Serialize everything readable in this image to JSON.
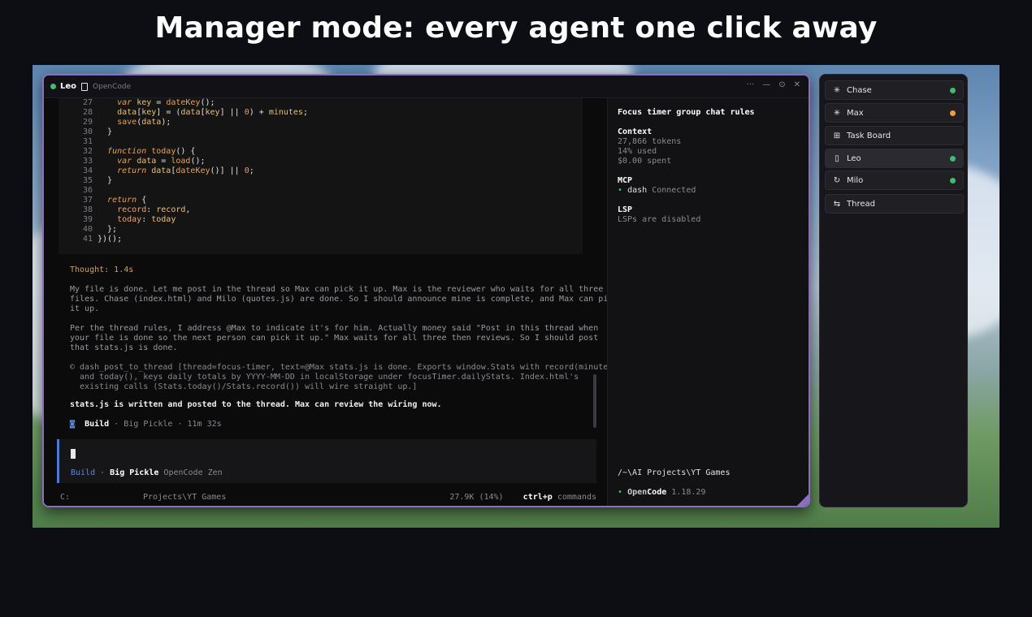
{
  "headline": "Manager mode: every agent one click away",
  "window": {
    "agent_name": "Leo",
    "app_name": "OpenCode",
    "controls": [
      "···",
      "—",
      "⊙",
      "✕"
    ]
  },
  "code": {
    "lines": [
      {
        "n": "27",
        "parts": [
          [
            "    ",
            "pl"
          ],
          [
            "var",
            "kw"
          ],
          [
            " ",
            "pl"
          ],
          [
            "key",
            "var"
          ],
          [
            " = ",
            "pl"
          ],
          [
            "dateKey",
            "fn"
          ],
          [
            "();",
            "pl"
          ]
        ]
      },
      {
        "n": "28",
        "parts": [
          [
            "    ",
            "pl"
          ],
          [
            "data",
            "var"
          ],
          [
            "[",
            "pl"
          ],
          [
            "key",
            "var"
          ],
          [
            "] = (",
            "pl"
          ],
          [
            "data",
            "var"
          ],
          [
            "[",
            "pl"
          ],
          [
            "key",
            "var"
          ],
          [
            "] || ",
            "pl"
          ],
          [
            "0",
            "num"
          ],
          [
            ") + ",
            "pl"
          ],
          [
            "minutes",
            "var"
          ],
          [
            ";",
            "pl"
          ]
        ]
      },
      {
        "n": "29",
        "parts": [
          [
            "    ",
            "pl"
          ],
          [
            "save",
            "fn"
          ],
          [
            "(",
            "pl"
          ],
          [
            "data",
            "var"
          ],
          [
            ");",
            "pl"
          ]
        ]
      },
      {
        "n": "30",
        "parts": [
          [
            "  }",
            "pl"
          ]
        ]
      },
      {
        "n": "31",
        "parts": [
          [
            "",
            "pl"
          ]
        ]
      },
      {
        "n": "32",
        "parts": [
          [
            "  ",
            "pl"
          ],
          [
            "function",
            "kw"
          ],
          [
            " ",
            "pl"
          ],
          [
            "today",
            "fn"
          ],
          [
            "() {",
            "pl"
          ]
        ]
      },
      {
        "n": "33",
        "parts": [
          [
            "    ",
            "pl"
          ],
          [
            "var",
            "kw"
          ],
          [
            " ",
            "pl"
          ],
          [
            "data",
            "var"
          ],
          [
            " = ",
            "pl"
          ],
          [
            "load",
            "fn"
          ],
          [
            "();",
            "pl"
          ]
        ]
      },
      {
        "n": "34",
        "parts": [
          [
            "    ",
            "pl"
          ],
          [
            "return",
            "kw"
          ],
          [
            " ",
            "pl"
          ],
          [
            "data",
            "var"
          ],
          [
            "[",
            "pl"
          ],
          [
            "dateKey",
            "fn"
          ],
          [
            "()] || ",
            "pl"
          ],
          [
            "0",
            "num"
          ],
          [
            ";",
            "pl"
          ]
        ]
      },
      {
        "n": "35",
        "parts": [
          [
            "  }",
            "pl"
          ]
        ]
      },
      {
        "n": "36",
        "parts": [
          [
            "",
            "pl"
          ]
        ]
      },
      {
        "n": "37",
        "parts": [
          [
            "  ",
            "pl"
          ],
          [
            "return",
            "kw"
          ],
          [
            " {",
            "pl"
          ]
        ]
      },
      {
        "n": "38",
        "parts": [
          [
            "    ",
            "pl"
          ],
          [
            "record",
            "prop"
          ],
          [
            ": ",
            "pl"
          ],
          [
            "record",
            "var"
          ],
          [
            ",",
            "pl"
          ]
        ]
      },
      {
        "n": "39",
        "parts": [
          [
            "    ",
            "pl"
          ],
          [
            "today",
            "prop"
          ],
          [
            ": ",
            "pl"
          ],
          [
            "today",
            "var"
          ]
        ]
      },
      {
        "n": "40",
        "parts": [
          [
            "  };",
            "pl"
          ]
        ]
      },
      {
        "n": "41",
        "parts": [
          [
            "})();",
            "pl"
          ]
        ]
      }
    ]
  },
  "thought": "Thought: 1.4s",
  "paragraphs": [
    "My file is done. Let me post in the thread so Max can pick it up. Max is the reviewer who waits for all three\nfiles. Chase (index.html) and Milo (quotes.js) are done. So I should announce mine is complete, and Max can pick\nit up.",
    "Per the thread rules, I address @Max to indicate it's for him. Actually money said \"Post in this thread when\nyour file is done so the next person can pick it up.\" Max waits for all three then reviews. So I should post\nthat stats.js is done."
  ],
  "tool_call": "© dash_post_to_thread [thread=focus-timer, text=@Max stats.js is done. Exports window.Stats with record(minutes)\n  and today(), keys daily totals by YYYY-MM-DD in localStorage under focusTimer.dailyStats. Index.html's\n  existing calls (Stats.today()/Stats.record()) will wire straight up.]",
  "final_message": "stats.js is written and posted to the thread. Max can review the wiring now.",
  "build_line": {
    "icon": "◙",
    "mode": "Build",
    "rest": " · Big Pickle · 11m 32s"
  },
  "input": {
    "mode": "Build",
    "model": "Big Pickle",
    "provider": "OpenCode Zen"
  },
  "statusbar": {
    "drive": "C:",
    "path": "Projects\\YT Games",
    "usage": "27.9K (14%)",
    "shortcut_key": "ctrl+p",
    "shortcut_label": "commands"
  },
  "sidebar": {
    "title": "Focus timer group chat rules",
    "context_heading": "Context",
    "context_lines": [
      "27,866 tokens",
      "14% used",
      "$0.00 spent"
    ],
    "mcp_heading": "MCP",
    "mcp_name": "dash",
    "mcp_status": "Connected",
    "lsp_heading": "LSP",
    "lsp_status": "LSPs are disabled",
    "cwd": "/~\\AI Projects\\YT Games",
    "version_dot": "•",
    "app_open": "Open",
    "app_code": "Code",
    "version": "1.18.29"
  },
  "panel": {
    "items": [
      {
        "label": "Chase",
        "icon": "✳",
        "status_color": "#3bbf6a"
      },
      {
        "label": "Max",
        "icon": "✳",
        "status_color": "#f0a030"
      },
      {
        "label": "Task Board",
        "icon": "⊞",
        "status_color": ""
      },
      {
        "label": "Leo",
        "icon": "▯",
        "status_color": "#3bbf6a"
      },
      {
        "label": "Milo",
        "icon": "↻",
        "status_color": "#3bbf6a"
      },
      {
        "label": "Thread",
        "icon": "⇆",
        "status_color": ""
      }
    ]
  },
  "colors": {
    "accent": "#8a6fc0",
    "build_blue": "#5a8ad8",
    "status_green": "#3bbf6a",
    "status_orange": "#f0a030"
  }
}
